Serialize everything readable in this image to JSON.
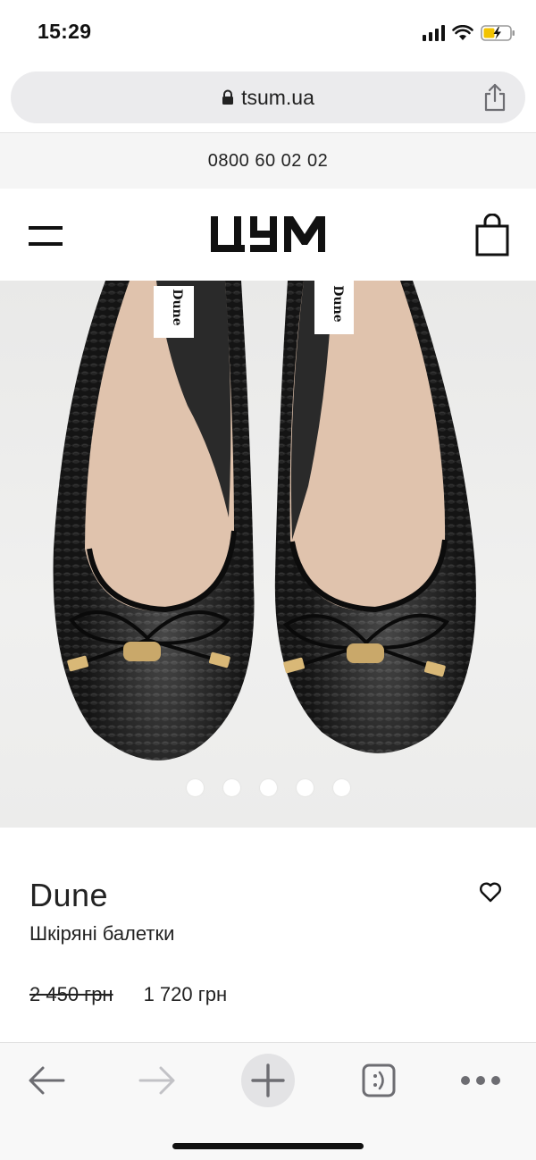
{
  "status_bar": {
    "time": "15:29",
    "icons": [
      "signal-icon",
      "wifi-icon",
      "battery-charging-icon"
    ]
  },
  "url_bar": {
    "lock_icon": "lock-icon",
    "url": "tsum.ua",
    "share_icon": "share-icon"
  },
  "phone_strip": {
    "phone": "0800 60 02 02"
  },
  "header": {
    "menu_icon": "hamburger-menu-icon",
    "logo_text": "ЦУМ",
    "bag_icon": "shopping-bag-icon"
  },
  "gallery": {
    "image_subject": "black snake-texture leather ballet flats with bow",
    "dot_count": 5,
    "active_index": 4
  },
  "product": {
    "brand": "Dune",
    "name": "Шкіряні балетки",
    "old_price": "2 450 грн",
    "new_price": "1 720 грн",
    "favorite_icon": "heart-outline-icon"
  },
  "toolbar": {
    "icons": [
      "back-arrow-icon",
      "forward-arrow-icon",
      "new-tab-plus-icon",
      "tabs-icon",
      "more-icon"
    ]
  },
  "colors": {
    "text": "#222222",
    "url_bar_bg": "#ebebed",
    "strip_bg": "#f5f5f5",
    "toolbar_bg": "#f8f8f8",
    "disabled": "#b8b8b8"
  }
}
